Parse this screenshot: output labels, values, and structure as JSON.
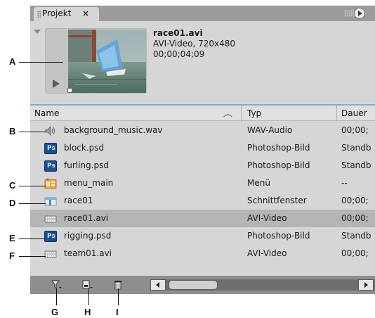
{
  "panel": {
    "tab_title": "Projekt",
    "tab_close": "×",
    "menu_icon": "panel-menu-icon"
  },
  "preview": {
    "clip_name": "race01.avi",
    "clip_desc": "AVI-Video, 720x480",
    "clip_duration": "00;00;04;09"
  },
  "columns": {
    "name": "Name",
    "type": "Typ",
    "duration": "Dauer"
  },
  "items": [
    {
      "name": "background_music.wav",
      "type": "WAV-Audio",
      "duration": "00;00;",
      "icon": "audio-icon",
      "selected": false
    },
    {
      "name": "block.psd",
      "type": "Photoshop-Bild",
      "duration": "Standb",
      "icon": "photoshop-file-icon",
      "selected": false
    },
    {
      "name": "furling.psd",
      "type": "Photoshop-Bild",
      "duration": "Standb",
      "icon": "photoshop-file-icon",
      "selected": false
    },
    {
      "name": "menu_main",
      "type": "Menü",
      "duration": "--",
      "icon": "menu-icon",
      "selected": false
    },
    {
      "name": "race01",
      "type": "Schnittfenster",
      "duration": "00;00;",
      "icon": "sequence-icon",
      "selected": false
    },
    {
      "name": "race01.avi",
      "type": "AVI-Video",
      "duration": "00;00;",
      "icon": "video-file-icon",
      "selected": true
    },
    {
      "name": "rigging.psd",
      "type": "Photoshop-Bild",
      "duration": "Standb",
      "icon": "photoshop-file-icon",
      "selected": false
    },
    {
      "name": "team01.avi",
      "type": "AVI-Video",
      "duration": "00;00;",
      "icon": "video-file-icon",
      "selected": false
    }
  ],
  "ps_label": "Ps",
  "bottom_icons": [
    "filter-icon",
    "new-item-icon",
    "delete-icon"
  ],
  "callouts": {
    "A": "A",
    "B": "B",
    "C": "C",
    "D": "D",
    "E": "E",
    "F": "F",
    "G": "G",
    "H": "H",
    "I": "I"
  },
  "colors": {
    "panel_bg": "#d6d6d6",
    "tabbar_bg": "#9b9b9b",
    "selected_row": "#b5b5b5",
    "header_accent": "#7fb0c8",
    "bottom_bar": "#8e8e8e"
  }
}
